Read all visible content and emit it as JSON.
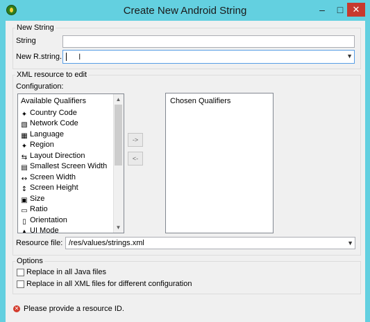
{
  "window": {
    "title": "Create New Android String",
    "minimize_glyph": "–",
    "maximize_glyph": "□",
    "close_glyph": "✕"
  },
  "new_string": {
    "group_title": "New String",
    "string_label": "String",
    "string_value": "",
    "rstring_label": "New R.string.",
    "rstring_value": ""
  },
  "xml_resource": {
    "group_title": "XML resource to edit",
    "configuration_label": "Configuration:",
    "available_header": "Available Qualifiers",
    "available_qualifiers": [
      {
        "label": "Country Code",
        "icon": "country-code-icon"
      },
      {
        "label": "Network Code",
        "icon": "network-code-icon"
      },
      {
        "label": "Language",
        "icon": "language-icon"
      },
      {
        "label": "Region",
        "icon": "region-icon"
      },
      {
        "label": "Layout Direction",
        "icon": "layout-direction-icon"
      },
      {
        "label": "Smallest Screen Width",
        "icon": "smallest-screen-width-icon"
      },
      {
        "label": "Screen Width",
        "icon": "screen-width-icon"
      },
      {
        "label": "Screen Height",
        "icon": "screen-height-icon"
      },
      {
        "label": "Size",
        "icon": "size-icon"
      },
      {
        "label": "Ratio",
        "icon": "ratio-icon"
      },
      {
        "label": "Orientation",
        "icon": "orientation-icon"
      },
      {
        "label": "UI Mode",
        "icon": "ui-mode-icon"
      }
    ],
    "add_button": "->",
    "remove_button": "<-",
    "chosen_header": "Chosen Qualifiers",
    "resource_file_label": "Resource file:",
    "resource_file_value": "/res/values/strings.xml"
  },
  "options": {
    "group_title": "Options",
    "replace_java": "Replace in all Java files",
    "replace_java_checked": false,
    "replace_xml": "Replace in all XML files for different configuration",
    "replace_xml_checked": false
  },
  "status": {
    "message": "Please provide a resource ID."
  },
  "colors": {
    "titlebar": "#63d0e0",
    "close_button": "#c7392d",
    "error": "#d33b2c"
  }
}
